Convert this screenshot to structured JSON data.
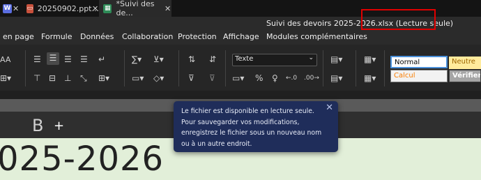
{
  "tabs": [
    {
      "label": "",
      "icon": "document-icon",
      "color": "#5b6ee1"
    },
    {
      "label": "20250902.ppt...",
      "icon": "presentation-icon",
      "color": "#c9513c"
    },
    {
      "label": "*Suivi des de...",
      "icon": "spreadsheet-icon",
      "color": "#2e8b57",
      "active": true
    }
  ],
  "window": {
    "title": "Suivi des devoirs 2025-2026.xlsx (Lecture seule)"
  },
  "menu": [
    "en page",
    "Formule",
    "Données",
    "Collaboration",
    "Protection",
    "Affichage",
    "Modules complémentaires"
  ],
  "ribbon": {
    "number_format": "Texte",
    "styles": [
      {
        "label": "Normal",
        "bg": "#ffffff",
        "fg": "#000000",
        "border": "#4a90d9"
      },
      {
        "label": "Neutre",
        "bg": "#ffeb9c",
        "fg": "#9c6500"
      },
      {
        "label": "Calcul",
        "bg": "#f2f2f2",
        "fg": "#fa7d00"
      },
      {
        "label": "Vérifier la",
        "bg": "#a5a5a5",
        "fg": "#ffffff"
      }
    ]
  },
  "sheet": {
    "column_label": "B",
    "cell_text": "025-2026"
  },
  "tooltip": {
    "text": "Le fichier est disponible en lecture seule. Pour sauvegarder vos modifications, enregistrez le fichier sous un nouveau nom ou à un autre endroit.",
    "close_glyph": "✕"
  }
}
